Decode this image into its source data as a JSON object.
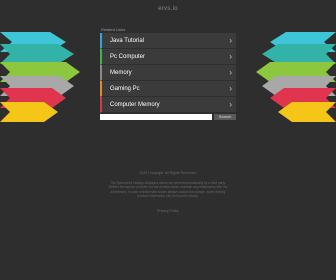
{
  "site": {
    "title": "ervs.io"
  },
  "panel": {
    "header": "Related Links",
    "items": [
      {
        "label": "Java Tutorial",
        "accent": "#3aa0d8"
      },
      {
        "label": "Pc Computer",
        "accent": "#46b04a"
      },
      {
        "label": "Memory",
        "accent": "#8a8a8a"
      },
      {
        "label": "Gaming Pc",
        "accent": "#e08a2a"
      },
      {
        "label": "Computer Memory",
        "accent": "#d43a4a"
      }
    ]
  },
  "search": {
    "placeholder": "",
    "button_label": "Search"
  },
  "footer": {
    "link": "2023 Copyright. All Rights Reserved.",
    "disclaimer": "The Sponsored Listings displayed above are served automatically by a third party. Neither the service provider nor the domain owner maintain any relationship with the advertisers. In case of trademark issues please contact the domain owner directly (contact information can be found in whois).",
    "privacy": "Privacy Policy"
  },
  "colors": {
    "background": "#2e2e2e",
    "wing_cyan": "#3ec6d8",
    "wing_teal": "#33b3a8",
    "wing_green": "#8dc63f",
    "wing_grey": "#a8a8a8",
    "wing_red": "#e0344f",
    "wing_yellow": "#f5c518"
  }
}
